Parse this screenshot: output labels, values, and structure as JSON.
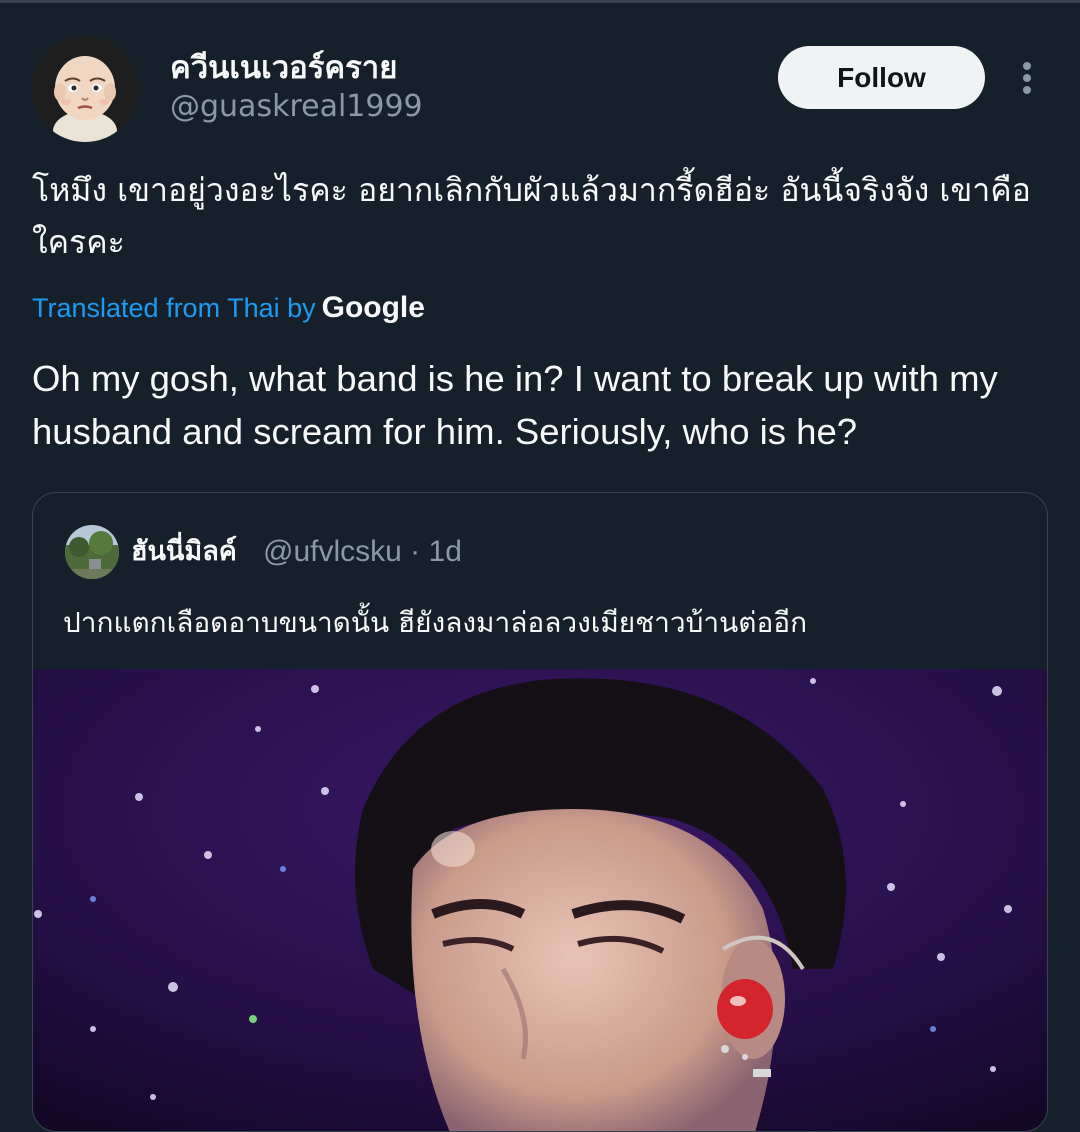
{
  "tweet": {
    "display_name": "ควีนเนเวอร์คราย",
    "handle": "@guaskreal1999",
    "follow_label": "Follow",
    "more_icon": "more-icon",
    "text": "โหมึง เขาอยู่วงอะไรคะ อยากเลิกกับผัวแล้วมากรี้ดฮีอ่ะ อันนี้จริงจัง เขาคือใครคะ",
    "translated_label": "Translated from Thai by",
    "translator": "Google",
    "translation": "Oh my gosh, what band is he in? I want to break up with my husband and scream for him. Seriously, who is he?"
  },
  "quote": {
    "display_name": "ฮันนี่มิลค์",
    "handle": "@ufvlcsku",
    "separator": "·",
    "time": "1d",
    "text": "ปากแตกเลือดอาบขนาดนั้น ฮียังลงมาล่อลวงเมียชาวบ้านต่ออีก"
  },
  "colors": {
    "background": "#15202b",
    "accent": "#1d9bf0",
    "text_primary": "#f7f9f9",
    "text_secondary": "#8b98a5",
    "border": "#38444d"
  }
}
